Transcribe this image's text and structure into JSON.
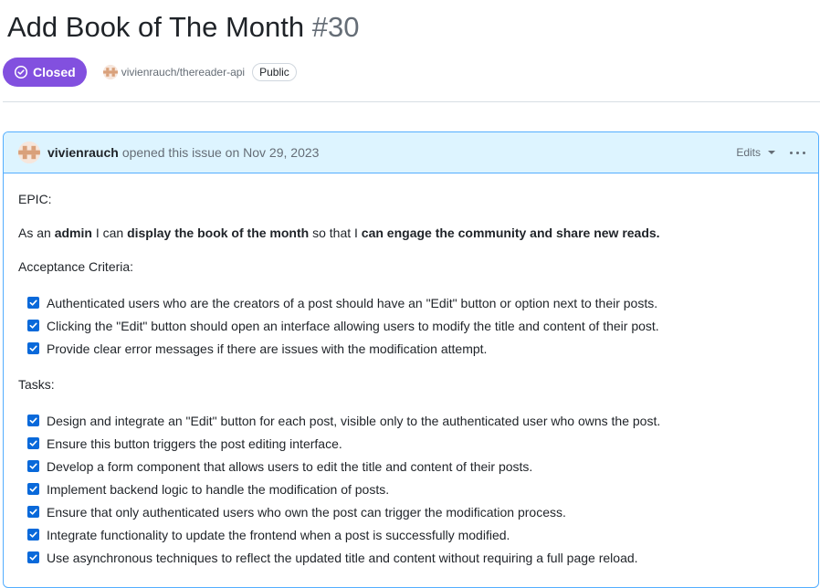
{
  "issue": {
    "title": "Add Book of The Month",
    "number": "#30",
    "state": "Closed",
    "repo": "vivienrauch/thereader-api",
    "visibility": "Public"
  },
  "comment": {
    "author": "vivienrauch",
    "action": "opened this issue on Nov 29, 2023",
    "edits_label": "Edits",
    "menu_icon": "kebab-horizontal-icon",
    "epic_label": "EPIC:",
    "story": {
      "p1": "As an ",
      "b1": "admin",
      "p2": " I can ",
      "b2": "display the book of the month",
      "p3": " so that I ",
      "b3": "can engage the community and share new reads."
    },
    "acceptance_heading": "Acceptance Criteria:",
    "acceptance_items": [
      "Authenticated users who are the creators of a post should have an \"Edit\" button or option next to their posts.",
      "Clicking the \"Edit\" button should open an interface allowing users to modify the title and content of their post.",
      "Provide clear error messages if there are issues with the modification attempt."
    ],
    "tasks_heading": "Tasks:",
    "task_items": [
      "Design and integrate an \"Edit\" button for each post, visible only to the authenticated user who owns the post.",
      "Ensure this button triggers the post editing interface.",
      "Develop a form component that allows users to edit the title and content of their posts.",
      "Implement backend logic to handle the modification of posts.",
      "Ensure that only authenticated users who own the post can trigger the modification process.",
      "Integrate functionality to update the frontend when a post is successfully modified.",
      "Use asynchronous techniques to reflect the updated title and content without requiring a full page reload."
    ]
  },
  "colors": {
    "closed_badge": "#8250df",
    "header_bg": "#ddf4ff",
    "header_border": "#54aeff",
    "checkbox": "#0969da"
  }
}
